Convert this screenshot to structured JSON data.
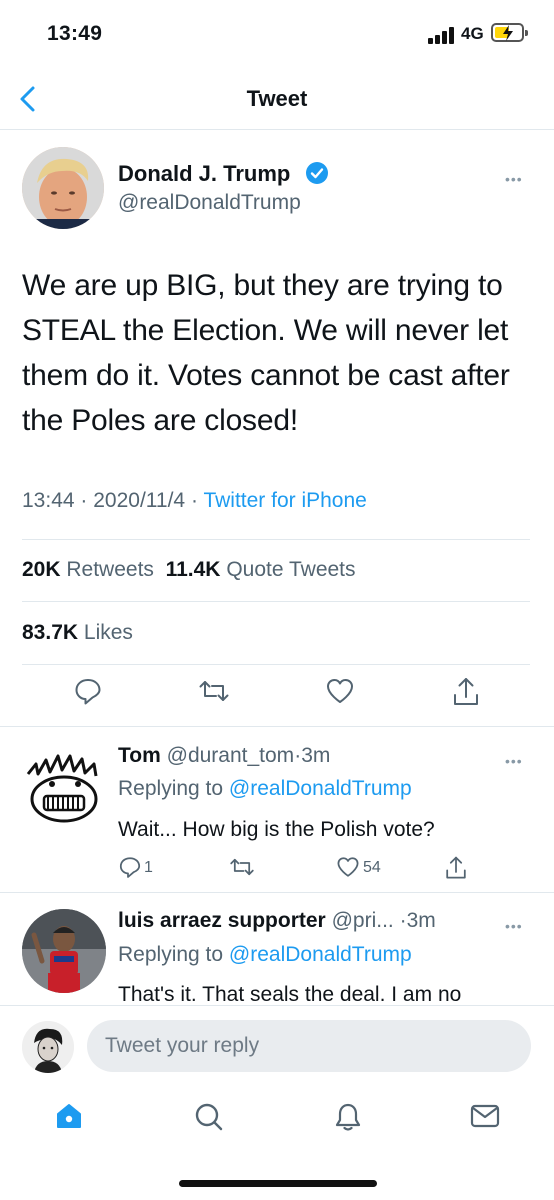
{
  "status_bar": {
    "time": "13:49",
    "network": "4G"
  },
  "nav": {
    "title": "Tweet"
  },
  "tweet": {
    "author_name": "Donald J. Trump",
    "author_handle": "@realDonaldTrump",
    "text": "We are up BIG, but they are trying to STEAL the Election. We will never let them do it. Votes cannot be cast after the Poles are closed!",
    "time": "13:44",
    "date": "2020/11/4",
    "source": "Twitter for iPhone",
    "separator": "·",
    "retweets_count": "20K",
    "retweets_label": "Retweets",
    "quotes_count": "11.4K",
    "quotes_label": "Quote Tweets",
    "likes_count": "83.7K",
    "likes_label": "Likes"
  },
  "replies": [
    {
      "name": "Tom",
      "handle": "@durant_tom",
      "time": "3m",
      "replying_prefix": "Replying to",
      "replying_to": "@realDonaldTrump",
      "text": "Wait... How big is the Polish vote?",
      "reply_count": "1",
      "retweet_count": "",
      "like_count": "54"
    },
    {
      "name": "luis arraez supporter",
      "handle": "@pri...",
      "time": "3m",
      "replying_prefix": "Replying to",
      "replying_to": "@realDonaldTrump",
      "text": "That's it. That seals the deal. I am no"
    }
  ],
  "compose": {
    "placeholder": "Tweet your reply"
  },
  "colors": {
    "accent": "#1d9bf0",
    "secondary_text": "#536471",
    "divider": "#e1e8ed"
  },
  "tab_bar": {
    "icons": [
      "home-icon",
      "search-icon",
      "notifications-icon",
      "messages-icon"
    ]
  }
}
